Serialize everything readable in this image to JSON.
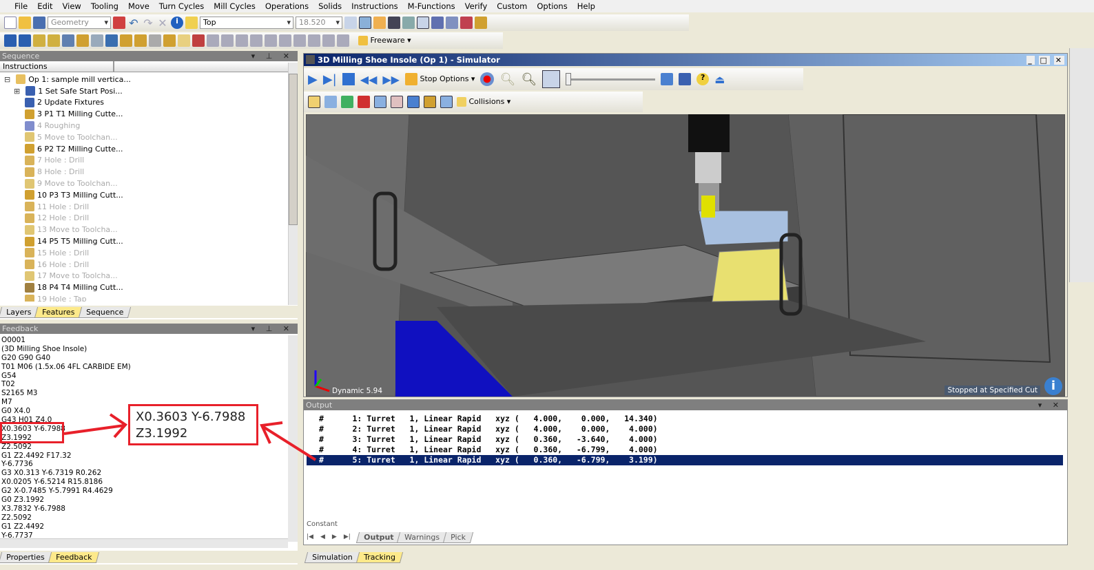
{
  "menu": [
    "File",
    "Edit",
    "View",
    "Tooling",
    "Move",
    "Turn Cycles",
    "Mill Cycles",
    "Operations",
    "Solids",
    "Instructions",
    "M-Functions",
    "Verify",
    "Custom",
    "Options",
    "Help"
  ],
  "toolbar": {
    "geometry_combo": "Geometry",
    "view_combo": "Top",
    "zoom_combo": "18.520",
    "freeware_label": "Freeware"
  },
  "sequence": {
    "title": "Sequence",
    "column": "Instructions",
    "items": [
      {
        "label": "Op 1: sample mill vertica...",
        "dim": false,
        "icon": "nc-icon"
      },
      {
        "label": "1 Set Safe Start Posi...",
        "dim": false,
        "icon": "safe-start-icon"
      },
      {
        "label": "2 Update Fixtures",
        "dim": false,
        "icon": "fixture-icon"
      },
      {
        "label": "3 P1 T1 Milling Cutte...",
        "dim": false,
        "icon": "milling-cutter-icon"
      },
      {
        "label": "4 Roughing",
        "dim": true,
        "icon": "roughing-icon"
      },
      {
        "label": "5 Move to Toolchan...",
        "dim": true,
        "icon": "toolchange-icon"
      },
      {
        "label": "6 P2 T2 Milling Cutte...",
        "dim": false,
        "icon": "milling-cutter-icon"
      },
      {
        "label": "7 Hole : Drill",
        "dim": true,
        "icon": "drill-icon"
      },
      {
        "label": "8 Hole : Drill",
        "dim": true,
        "icon": "drill-icon"
      },
      {
        "label": "9 Move to Toolchan...",
        "dim": true,
        "icon": "toolchange-icon"
      },
      {
        "label": "10 P3 T3 Milling Cutt...",
        "dim": false,
        "icon": "milling-cutter-icon"
      },
      {
        "label": "11 Hole : Drill",
        "dim": true,
        "icon": "drill-icon"
      },
      {
        "label": "12 Hole : Drill",
        "dim": true,
        "icon": "drill-icon"
      },
      {
        "label": "13 Move to Toolcha...",
        "dim": true,
        "icon": "toolchange-icon"
      },
      {
        "label": "14 P5 T5 Milling Cutt...",
        "dim": false,
        "icon": "milling-cutter-icon"
      },
      {
        "label": "15 Hole : Drill",
        "dim": true,
        "icon": "drill-icon"
      },
      {
        "label": "16 Hole : Drill",
        "dim": true,
        "icon": "drill-icon"
      },
      {
        "label": "17 Move to Toolcha...",
        "dim": true,
        "icon": "toolchange-icon"
      },
      {
        "label": "18 P4 T4 Milling Cutt...",
        "dim": false,
        "icon": "tap-cutter-icon"
      },
      {
        "label": "19 Hole : Tap",
        "dim": true,
        "icon": "drill-icon"
      }
    ],
    "tabs": [
      "Layers",
      "Features",
      "Sequence"
    ],
    "active_tab": "Features"
  },
  "feedback": {
    "title": "Feedback",
    "lines": [
      "O0001",
      "(3D Milling Shoe Insole)",
      " G20 G90 G40",
      " T01 M06 (1.5x.06 4FL CARBIDE EM)",
      " G54",
      " T02",
      " S2165 M3",
      " M7",
      " G0 X4.0",
      " G43 H01 Z4.0",
      "X0.3603 Y-6.7988",
      "Z3.1992",
      " Z2.5092",
      " G1 Z2.4492 F17.32",
      " Y-6.7736",
      " G3 X0.313 Y-6.7319 R0.262",
      " X0.0205 Y-6.5214 R15.8186",
      " G2 X-0.7485 Y-5.7991 R4.4629",
      " G0 Z3.1992",
      " X3.7832 Y-6.7988",
      " Z2.5092",
      " G1 Z2.4492",
      " Y-6.7737"
    ],
    "tabs": [
      "Properties",
      "Feedback"
    ],
    "active_tab": "Feedback"
  },
  "callout": {
    "line1": "X0.3603 Y-6.7988",
    "line2": "Z3.1992",
    "color": "#e8202a"
  },
  "simulator": {
    "title": "3D Milling Shoe Insole (Op 1) - Simulator",
    "stop_options": "Stop Options",
    "collisions": "Collisions",
    "speed_slider": 0.0,
    "dynamic_label": "Dynamic 5.94",
    "status": "Stopped at Specified Cut"
  },
  "output": {
    "title": "Output",
    "rows": [
      "#      1: Turret   1, Linear Rapid   xyz (   4.000,    0.000,   14.340)",
      "#      2: Turret   1, Linear Rapid   xyz (   4.000,    0.000,    4.000)",
      "#      3: Turret   1, Linear Rapid   xyz (   0.360,   -3.640,    4.000)",
      "#      4: Turret   1, Linear Rapid   xyz (   0.360,   -6.799,    4.000)",
      "#      5: Turret   1, Linear Rapid   xyz (   0.360,   -6.799,    3.199)"
    ],
    "selected_row": 4,
    "partial_label": "Constant",
    "tabs": [
      "Output",
      "Warnings",
      "Pick"
    ],
    "active_tab": "Output"
  },
  "bottom_tabs": [
    "Simulation",
    "Tracking"
  ],
  "bottom_active": "Tracking",
  "colors": {
    "selection": "#0a246a",
    "title_bar_start": "#0a246a",
    "title_bar_end": "#a6caf0",
    "fixture_yellow": "#e8e070"
  }
}
